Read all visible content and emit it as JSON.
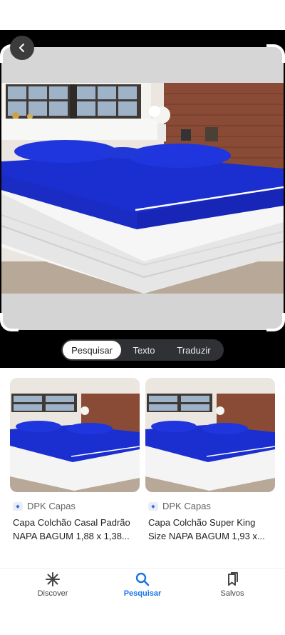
{
  "lens": {
    "back_icon": "chevron-left-icon",
    "modes": [
      {
        "label": "Pesquisar",
        "active": true
      },
      {
        "label": "Texto",
        "active": false
      },
      {
        "label": "Traduzir",
        "active": false
      }
    ]
  },
  "results": [
    {
      "source": "DPK Capas",
      "title": "Capa Colchão Casal Padrão NAPA BAGUM 1,88 x 1,38..."
    },
    {
      "source": "DPK Capas",
      "title": "Capa Colchão Super King Size NAPA BAGUM 1,93 x..."
    }
  ],
  "bottom_nav": {
    "items": [
      {
        "label": "Discover",
        "icon": "asterisk-icon",
        "active": false
      },
      {
        "label": "Pesquisar",
        "icon": "search-icon",
        "active": true
      },
      {
        "label": "Salvos",
        "icon": "bookmarks-icon",
        "active": false
      }
    ]
  },
  "colors": {
    "accent": "#1a73e8",
    "bed_cover": "#1b2fd0",
    "pill_bg": "#303134"
  }
}
